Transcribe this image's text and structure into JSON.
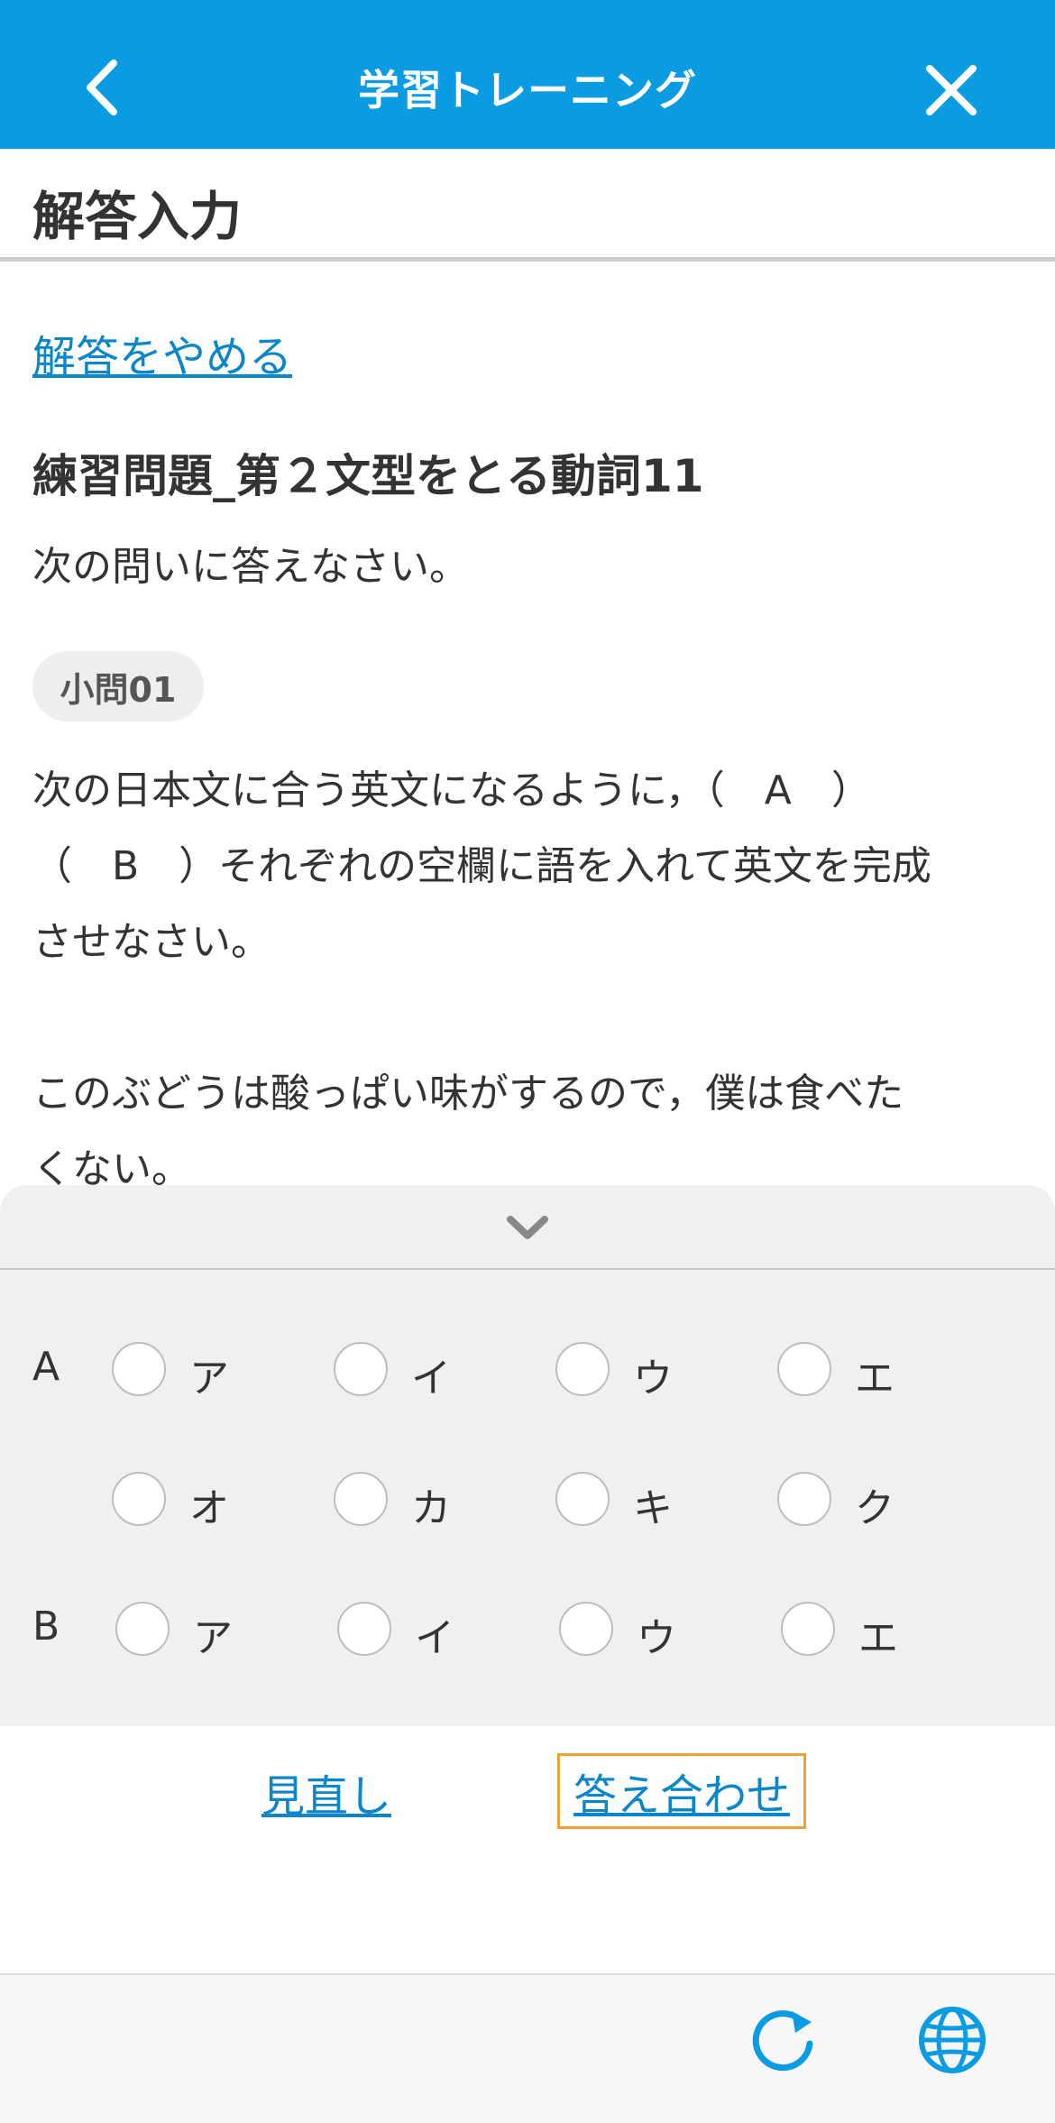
{
  "nav": {
    "title": "学習トレーニング"
  },
  "section": {
    "title": "解答入力"
  },
  "cancel_link": "解答をやめる",
  "question": {
    "title": "練習問題_第２文型をとる動詞11",
    "instruction": "次の問いに答えなさい。",
    "badge": "小問01",
    "text_line1": "次の日本文に合う英文になるように，（　A　）",
    "text_line2": "（　B　）それぞれの空欄に語を入れて英文を完成",
    "text_line3": "させなさい。",
    "text_line4": "このぶどうは酸っぱい味がするので，僕は食べた",
    "text_line5": "くない。"
  },
  "answers": {
    "a_label": "A",
    "b_label": "B",
    "a_options": [
      "ア",
      "イ",
      "ウ",
      "エ",
      "オ",
      "カ",
      "キ",
      "ク"
    ],
    "b_options": [
      "ア",
      "イ",
      "ウ",
      "エ"
    ]
  },
  "actions": {
    "review": "見直し",
    "check": "答え合わせ"
  },
  "colors": {
    "header": "#0a9be3",
    "link": "#0a86c9",
    "highlight_border": "#f0a032"
  },
  "icons": [
    "back-icon",
    "close-icon",
    "chevron-down-icon",
    "refresh-icon",
    "globe-icon"
  ]
}
